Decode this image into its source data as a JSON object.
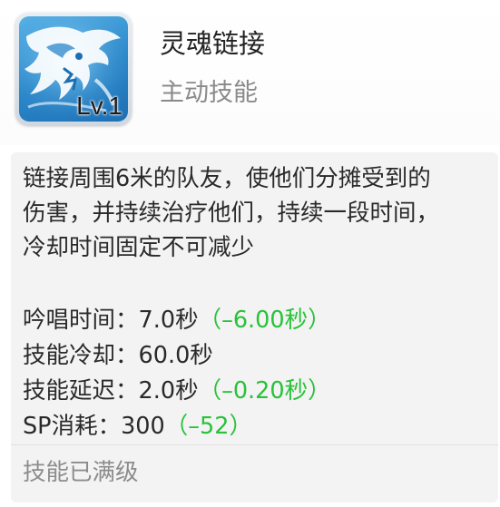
{
  "skill": {
    "name": "灵魂链接",
    "type": "主动技能",
    "level_label": "Lv.1",
    "icon": "spirit-wolf-icon"
  },
  "description": {
    "lines": [
      "链接周围6米的队友，使他们分摊受到的",
      "伤害，并持续治疗他们，持续一段时间，",
      "冷却时间固定不可减少"
    ]
  },
  "stats": [
    {
      "label": "吟唱时间：",
      "value": "7.0秒",
      "bonus": "（–6.00秒）"
    },
    {
      "label": "技能冷却：",
      "value": "60.0秒",
      "bonus": ""
    },
    {
      "label": "技能延迟：",
      "value": "2.0秒",
      "bonus": "（–0.20秒）"
    },
    {
      "label": "SP消耗：",
      "value": "300",
      "bonus": "（–52）"
    }
  ],
  "footer": {
    "status": "技能已满级"
  },
  "colors": {
    "bonus": "#29c23a",
    "title": "#222222",
    "subtitle": "#8a8a8a",
    "panel_bg": "#f3f3f3",
    "icon_blue": "#2a86c9"
  }
}
